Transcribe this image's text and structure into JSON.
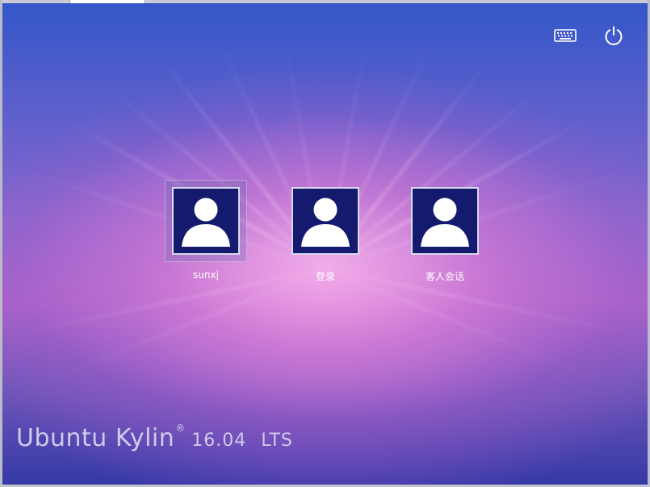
{
  "topbar": {
    "keyboard_icon": "keyboard-icon",
    "power_icon": "power-icon"
  },
  "users": [
    {
      "name": "sunxj",
      "icon": "user-avatar-icon",
      "selected": true
    },
    {
      "name": "登录",
      "icon": "user-avatar-icon",
      "selected": false
    },
    {
      "name": "客人会话",
      "icon": "user-avatar-icon",
      "selected": false
    }
  ],
  "branding": {
    "name": "Ubuntu Kylin",
    "mark": "®",
    "version": "16.04",
    "edition": "LTS"
  },
  "colors": {
    "avatar_background": "#141b6f",
    "avatar_border": "#d8d8ee",
    "text": "#ffffff",
    "branding_text": "#cfcbea"
  }
}
